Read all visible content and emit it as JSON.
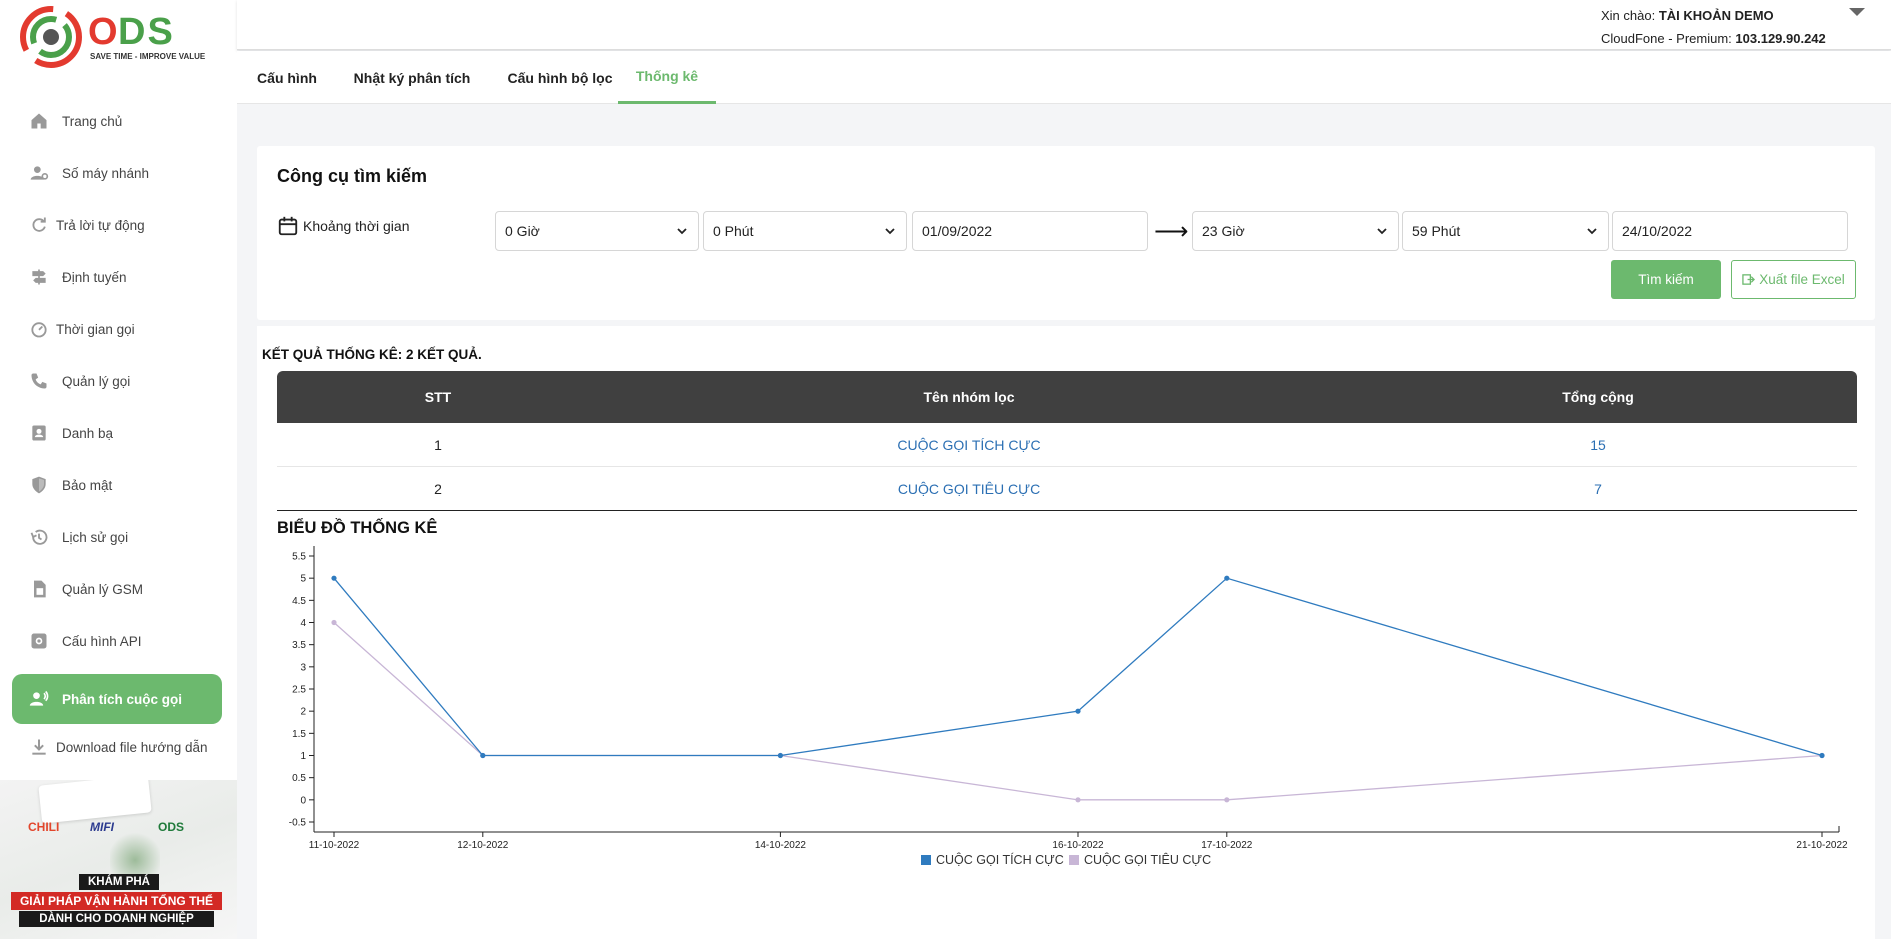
{
  "sidebar": {
    "logo_text": "ODS",
    "logo_tagline": "SAVE TIME - IMPROVE VALUE",
    "items": [
      {
        "label": "Trang chủ",
        "icon": "home-icon"
      },
      {
        "label": "Số máy nhánh",
        "icon": "user-settings-icon"
      },
      {
        "label": "Trả lời tự động",
        "icon": "refresh-icon"
      },
      {
        "label": "Định tuyến",
        "icon": "signpost-icon"
      },
      {
        "label": "Thời gian gọi",
        "icon": "timer-icon"
      },
      {
        "label": "Quản lý gọi",
        "icon": "phone-icon"
      },
      {
        "label": "Danh bạ",
        "icon": "contacts-icon"
      },
      {
        "label": "Bảo mật",
        "icon": "shield-icon"
      },
      {
        "label": "Lịch sử gọi",
        "icon": "history-icon"
      },
      {
        "label": "Quản lý GSM",
        "icon": "sim-card-icon"
      },
      {
        "label": "Cấu hình API",
        "icon": "api-gear-icon"
      },
      {
        "label": "Phân tích cuộc gọi",
        "icon": "user-voice-icon",
        "active": true
      },
      {
        "label": "Download file hướng dẫn",
        "icon": "download-icon"
      }
    ],
    "promo": {
      "brand1": "CHILI",
      "brand2": "MIFI",
      "brand3": "ODS",
      "line1": "KHÁM PHÁ",
      "line2": "GIẢI PHÁP VẬN HÀNH TỔNG THỂ",
      "line3": "DÀNH CHO DOANH NGHIỆP"
    }
  },
  "header": {
    "greeting_prefix": "Xin chào:",
    "account_name": "TÀI KHOẢN DEMO",
    "plan_prefix": "CloudFone - Premium:",
    "ip": "103.129.90.242"
  },
  "tabs": [
    {
      "label": "Cấu hình"
    },
    {
      "label": "Nhật ký phân tích"
    },
    {
      "label": "Cấu hình bộ lọc"
    },
    {
      "label": "Thống kê",
      "active": true
    }
  ],
  "search": {
    "title": "Công cụ tìm kiếm",
    "range_label": "Khoảng thời gian",
    "from_hour": "0 Giờ",
    "from_minute": "0 Phút",
    "from_date": "01/09/2022",
    "to_hour": "23 Giờ",
    "to_minute": "59 Phút",
    "to_date": "24/10/2022",
    "search_btn": "Tìm kiếm",
    "export_btn": "Xuất file Excel"
  },
  "results": {
    "title": "KẾT QUẢ THỐNG KÊ: 2 KẾT QUẢ.",
    "columns": [
      "STT",
      "Tên nhóm lọc",
      "Tổng cộng"
    ],
    "rows": [
      {
        "stt": "1",
        "name": "CUỘC GỌI TÍCH CỰC",
        "total": "15"
      },
      {
        "stt": "2",
        "name": "CUỘC GỌI TIÊU CỰC",
        "total": "7"
      }
    ],
    "chart_title": "BIỂU ĐỒ THỐNG KÊ"
  },
  "chart_data": {
    "type": "line",
    "title": "BIỂU ĐỒ THỐNG KÊ",
    "x": [
      "11-10-2022",
      "12-10-2022",
      "14-10-2022",
      "16-10-2022",
      "17-10-2022",
      "21-10-2022"
    ],
    "x_tick_labels": [
      "11-10-2022",
      "12-10-2022",
      "14-10-2022",
      "16-10-2022",
      "17-10-2022",
      "21-10-2022"
    ],
    "series": [
      {
        "name": "CUỘC GỌI TÍCH CỰC",
        "color": "#2f7bbf",
        "values": [
          5,
          1,
          1,
          2,
          5,
          1
        ]
      },
      {
        "name": "CUỘC GỌI TIÊU CỰC",
        "color": "#c8b6d6",
        "values": [
          4,
          1,
          1,
          0,
          0,
          1
        ]
      }
    ],
    "y_ticks": [
      "-0.5",
      "0",
      "0.5",
      "1",
      "1.5",
      "2",
      "2.5",
      "3",
      "3.5",
      "4",
      "4.5",
      "5",
      "5.5"
    ],
    "ylim": [
      -0.5,
      5.5
    ],
    "legend_position": "bottom-center",
    "grid": false
  }
}
